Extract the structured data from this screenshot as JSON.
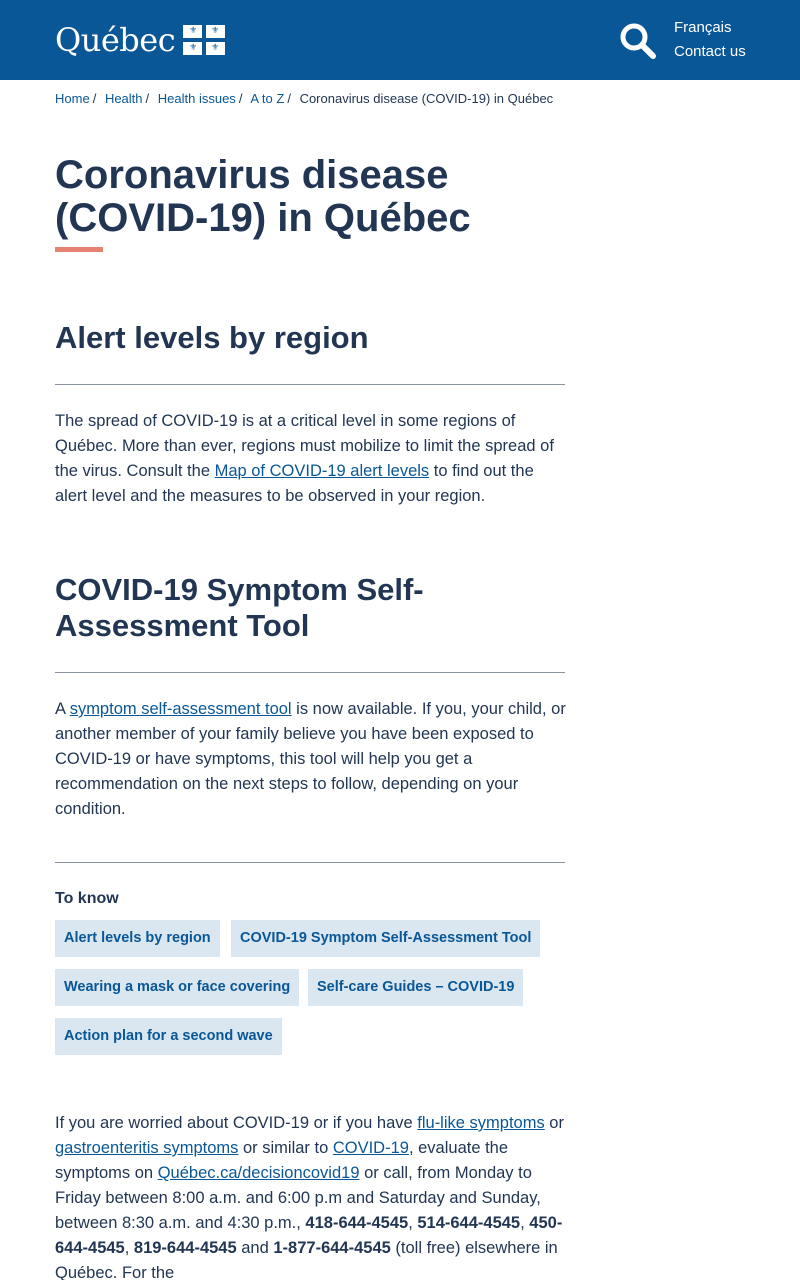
{
  "header": {
    "logo_text": "Québec",
    "links": [
      "Français",
      "Contact us"
    ],
    "search_icon": "search-icon",
    "brand_color": "#095797"
  },
  "breadcrumb": [
    "Home",
    "Health",
    "Health issues",
    "A to Z",
    "Coronavirus disease (COVID-19) in Québec"
  ],
  "page": {
    "title": "Coronavirus disease (COVID-19) in Québec",
    "accent_color": "#e58271"
  },
  "alert_section": {
    "heading": "Alert levels by region",
    "text_before": "The spread of COVID-19 is at a critical level in some regions of Québec. More than ever, regions must mobilize to limit the spread of the virus. Consult the ",
    "link": "Map of COVID-19 alert levels",
    "text_after": " to find out the alert level and the measures to be observed in your region."
  },
  "tool_section": {
    "heading": "COVID-19 Symptom Self-Assessment Tool",
    "text_before": "A ",
    "link": "symptom self-assessment tool",
    "text_after": " is now available. If you, your child, or another member of your family believe you have been exposed to COVID-19 or have symptoms, this tool will help you get a recommendation on the next steps to follow, depending on your condition."
  },
  "to_know": {
    "label": "To know",
    "chips": [
      "Alert levels by region",
      "COVID-19 Symptom Self-Assessment Tool",
      "Wearing a mask or face covering",
      "Self-care Guides – COVID-19",
      "Action plan for a second wave"
    ]
  },
  "info": {
    "t1": "If you are worried about COVID-19 or if you have ",
    "l1": "flu-like symptoms",
    "t2": " or ",
    "l2": "gastroenteritis symptoms",
    "t3": " or similar to ",
    "l3": "COVID-19",
    "t4": ", evaluate the symptoms on ",
    "l4": "Québec.ca/decisioncovid19",
    "t5": " or call, from Monday to Friday between 8:00 a.m. and 6:00 p.m and Saturday and Sunday, between 8:30 a.m. and 4:30 p.m., ",
    "p1": "418-644-4545",
    "c1": ", ",
    "p2": "514-644-4545",
    "c2": ", ",
    "p3": "450-644-4545",
    "c3": ", ",
    "p4": "819-644-4545",
    "t6": " and ",
    "p5": "1-877-644-4545",
    "t7": " (toll free) elsewhere in Québec. For the"
  }
}
